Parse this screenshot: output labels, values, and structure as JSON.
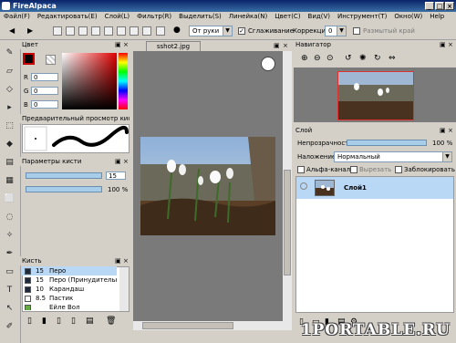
{
  "app": {
    "title": "FireAlpaca",
    "tab": "sshot2.jpg"
  },
  "menu": [
    "Файл(F)",
    "Редактировать(E)",
    "Слой(L)",
    "Фильтр(R)",
    "Выделить(S)",
    "Линейка(N)",
    "Цвет(C)",
    "Вид(V)",
    "Инструмент(T)",
    "Окно(W)",
    "Help"
  ],
  "toolbar": {
    "brush_mode": "От руки",
    "smoothing_label": "Сглаживание",
    "correction_label": "Коррекция",
    "correction_value": "0",
    "blur_edge_label": "Размытый край"
  },
  "color_panel": {
    "title": "Цвет",
    "r_label": "R",
    "g_label": "G",
    "b_label": "B",
    "r": "0",
    "g": "0",
    "b": "0"
  },
  "preview_panel": {
    "title": "Предварительный просмотр кисти"
  },
  "brush_params": {
    "title": "Параметры кисти",
    "size": "15",
    "opacity": "100 %"
  },
  "brush_panel": {
    "title": "Кисть",
    "items": [
      {
        "size": "15",
        "name": "Перо",
        "color": "#1e2a3a"
      },
      {
        "size": "15",
        "name": "Перо (Принудительно)",
        "color": "#1e2a3a"
      },
      {
        "size": "10",
        "name": "Карандаш",
        "color": "#1e2a3a"
      },
      {
        "size": "8.5",
        "name": "Пастик",
        "color": "#ffffff"
      },
      {
        "size": "",
        "name": "Ейле Вол",
        "color": "#66aa44"
      }
    ]
  },
  "navigator": {
    "title": "Навигатор"
  },
  "layer_panel": {
    "title": "Слой",
    "opacity_label": "Непрозрачность",
    "opacity_value": "100 %",
    "opacity": 1.0,
    "blend_label": "Наложение",
    "blend_value": "Нормальный",
    "alpha_label": "Альфа-канал",
    "clip_label": "Вырезать",
    "lock_label": "Заблокировать",
    "layer_name": "Слой1"
  },
  "watermark": "1PORTABLE.RU"
}
